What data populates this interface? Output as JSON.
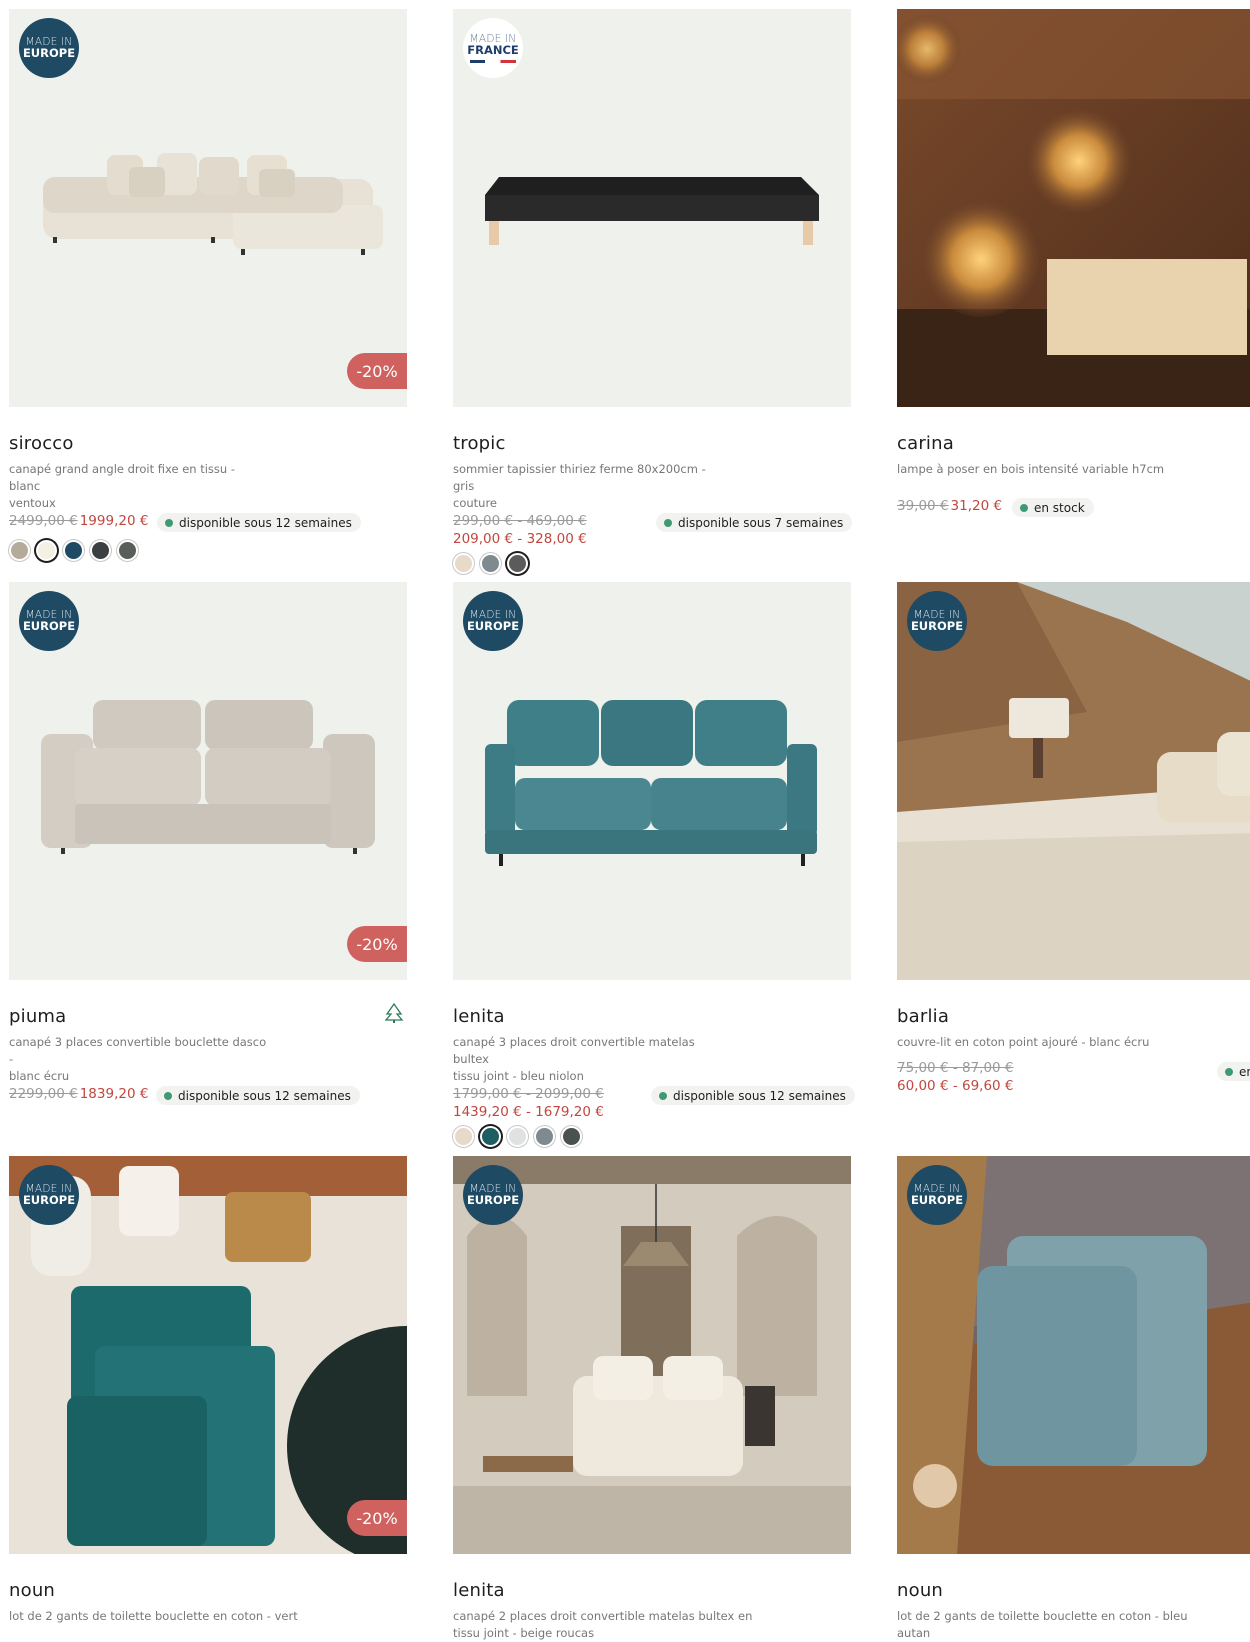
{
  "badges": {
    "europe_l1": "MADE IN",
    "europe_l2": "EUROPE",
    "france_l1": "MADE IN",
    "france_l2": "FRANCE"
  },
  "promo": "-20%",
  "products": [
    {
      "name": "sirocco",
      "desc1": "canapé grand angle droit fixe en tissu - blanc",
      "desc2": "ventoux",
      "old": "2499,00 €",
      "new": "1999,20 €",
      "availability": "disponible sous 12 semaines",
      "swatches": [
        "#b6ab9a",
        "#f4f0e4",
        "#1f4a64",
        "#3b3f44",
        "#5a5e5a"
      ]
    },
    {
      "name": "tropic",
      "desc1": "sommier tapissier thiriez ferme 80x200cm - gris",
      "desc2": "couture",
      "old": "299,00 € - 469,00 €",
      "new": "209,00 € - 328,00 €",
      "availability": "disponible sous 7 semaines",
      "swatches": [
        "#e7dac8",
        "#7e8990",
        "#5b5b5b"
      ]
    },
    {
      "name": "carina",
      "desc1": "lampe à poser en bois intensité variable h7cm",
      "desc2": "",
      "old": "39,00 €",
      "new": "31,20 €",
      "availability": "en stock"
    },
    {
      "name": "piuma",
      "desc1": "canapé 3 places convertible bouclette dasco -",
      "desc2": "blanc écru",
      "old": "2299,00 €",
      "new": "1839,20 €",
      "availability": "disponible sous 12 semaines"
    },
    {
      "name": "lenita",
      "desc1": "canapé 3 places droit convertible matelas bultex",
      "desc2": "tissu joint - bleu niolon",
      "old": "1799,00 € - 2099,00 €",
      "new": "1439,20 € - 1679,20 €",
      "availability": "disponible sous 12 semaines",
      "swatches": [
        "#e7dac8",
        "#1e5e63",
        "#dfe2e0",
        "#7e8990",
        "#4a524f"
      ]
    },
    {
      "name": "barlia",
      "desc1": "couvre-lit en coton point ajouré - blanc écru",
      "desc2": "",
      "old": "75,00 € - 87,00 €",
      "new": "60,00 € - 69,60 €",
      "availability": "en"
    },
    {
      "name": "noun",
      "desc1": "lot de 2 gants de toilette bouclette en coton - vert",
      "desc2": ""
    },
    {
      "name": "lenita",
      "desc1": "canapé 2 places droit convertible matelas bultex en",
      "desc2": "tissu joint - beige roucas"
    },
    {
      "name": "noun",
      "desc1": "lot de 2 gants de toilette bouclette en coton - bleu",
      "desc2": "autan"
    }
  ]
}
